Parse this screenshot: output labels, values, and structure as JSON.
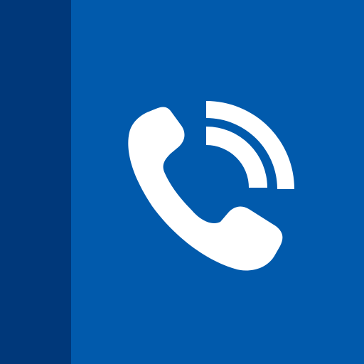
{
  "icon": {
    "name": "phone-book-app-icon",
    "glyph": "phone-ringing-icon",
    "colors": {
      "spine": "#00387A",
      "cover": "#015AAC",
      "glyph": "#FFFFFF"
    }
  }
}
